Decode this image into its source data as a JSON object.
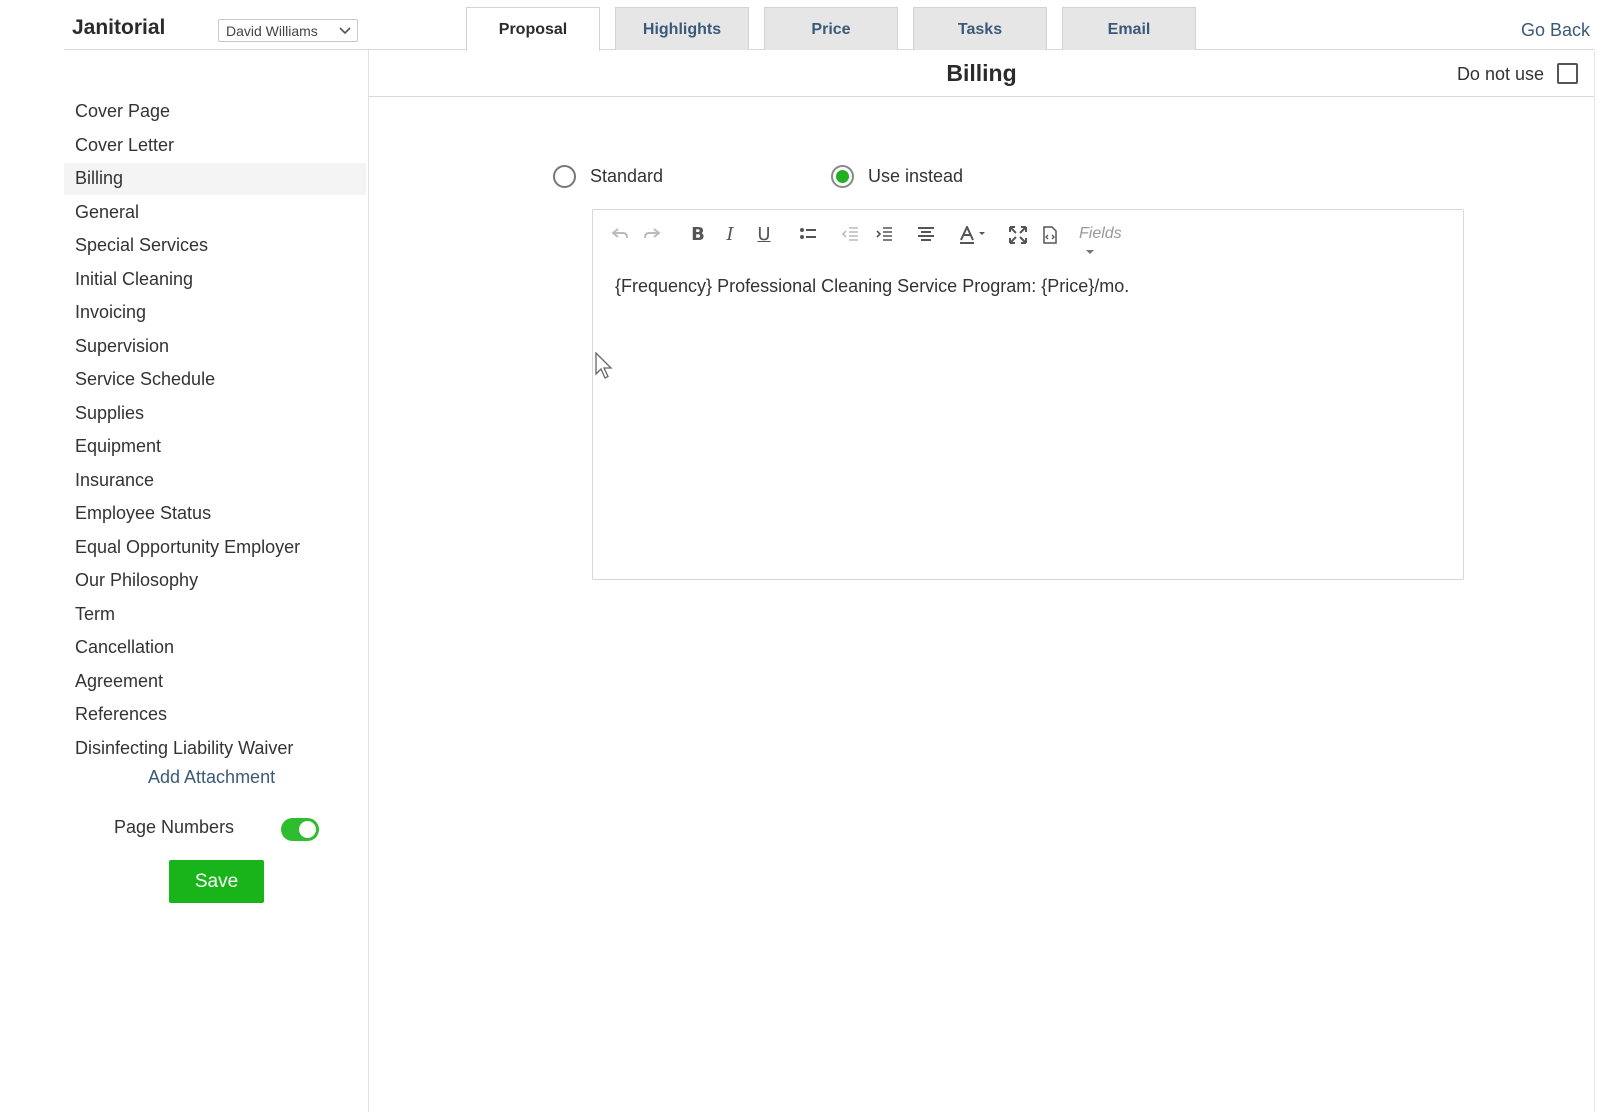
{
  "header": {
    "app_title": "Janitorial",
    "user_select": "David Williams",
    "go_back": "Go Back",
    "tabs": [
      {
        "label": "Proposal",
        "active": true
      },
      {
        "label": "Highlights",
        "active": false
      },
      {
        "label": "Price",
        "active": false
      },
      {
        "label": "Tasks",
        "active": false
      },
      {
        "label": "Email",
        "active": false
      }
    ]
  },
  "sidebar": {
    "items": [
      {
        "label": "Cover Page"
      },
      {
        "label": "Cover Letter"
      },
      {
        "label": "Billing",
        "active": true
      },
      {
        "label": "General"
      },
      {
        "label": "Special Services"
      },
      {
        "label": "Initial Cleaning"
      },
      {
        "label": "Invoicing"
      },
      {
        "label": "Supervision"
      },
      {
        "label": "Service Schedule"
      },
      {
        "label": "Supplies"
      },
      {
        "label": "Equipment"
      },
      {
        "label": "Insurance"
      },
      {
        "label": "Employee Status"
      },
      {
        "label": "Equal Opportunity Employer"
      },
      {
        "label": "Our Philosophy"
      },
      {
        "label": "Term"
      },
      {
        "label": "Cancellation"
      },
      {
        "label": "Agreement"
      },
      {
        "label": "References"
      },
      {
        "label": "Disinfecting Liability Waiver"
      }
    ],
    "add_attachment": "Add Attachment",
    "page_numbers_label": "Page Numbers",
    "page_numbers_on": true,
    "save_label": "Save"
  },
  "content": {
    "title": "Billing",
    "do_not_use_label": "Do not use",
    "do_not_use_checked": false,
    "radio_standard": "Standard",
    "radio_use_instead": "Use instead",
    "selected_option": "Use instead",
    "editor": {
      "fields_label": "Fields",
      "text": "{Frequency} Professional Cleaning Service Program: {Price}/mo."
    }
  },
  "colors": {
    "accent_green": "#18b41a",
    "link_blue": "#3b5a7a",
    "tab_bg": "#e6e6e6"
  },
  "icons": [
    "chevron-down-icon",
    "undo-icon",
    "redo-icon",
    "bold-icon",
    "italic-icon",
    "underline-icon",
    "bullet-list-icon",
    "outdent-icon",
    "indent-icon",
    "align-center-icon",
    "font-color-icon",
    "fullscreen-icon",
    "source-code-icon",
    "cursor-icon"
  ]
}
